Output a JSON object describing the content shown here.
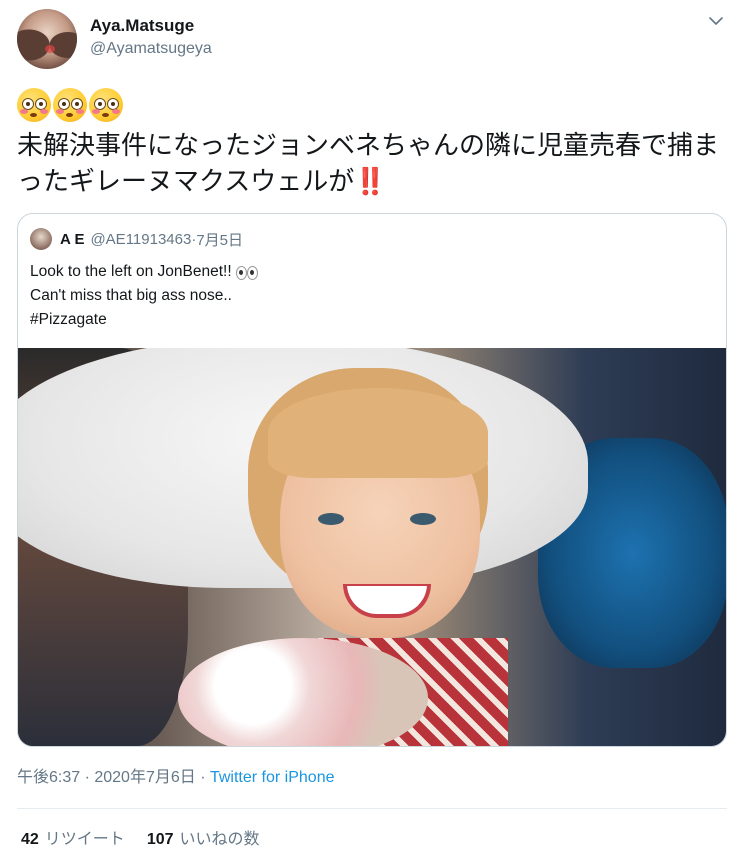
{
  "author": {
    "display_name": "Aya.Matsuge",
    "handle": "@Ayamatsugeya"
  },
  "tweet": {
    "text": "未解決事件になったジョンベネちゃんの隣に児童売春で捕まったギレーヌマクスウェルが",
    "trailing_emoji": "‼️",
    "leading_emojis": [
      "flushed-face-icon",
      "flushed-face-icon",
      "flushed-face-icon"
    ]
  },
  "quoted_tweet": {
    "name": "A E",
    "handle": "@AE11913463",
    "separator": " · ",
    "date": "7月5日",
    "lines": [
      "Look to the left on JonBenet!!",
      "Can't miss that big ass nose..",
      "#Pizzagate"
    ],
    "line1_emoji": "eyes-icon"
  },
  "meta": {
    "time": "午後6:37 · 2020年7月6日 · ",
    "source": "Twitter for iPhone"
  },
  "stats": {
    "retweets_count": "42",
    "retweets_label": "リツイート",
    "likes_count": "107",
    "likes_label": "いいねの数"
  }
}
